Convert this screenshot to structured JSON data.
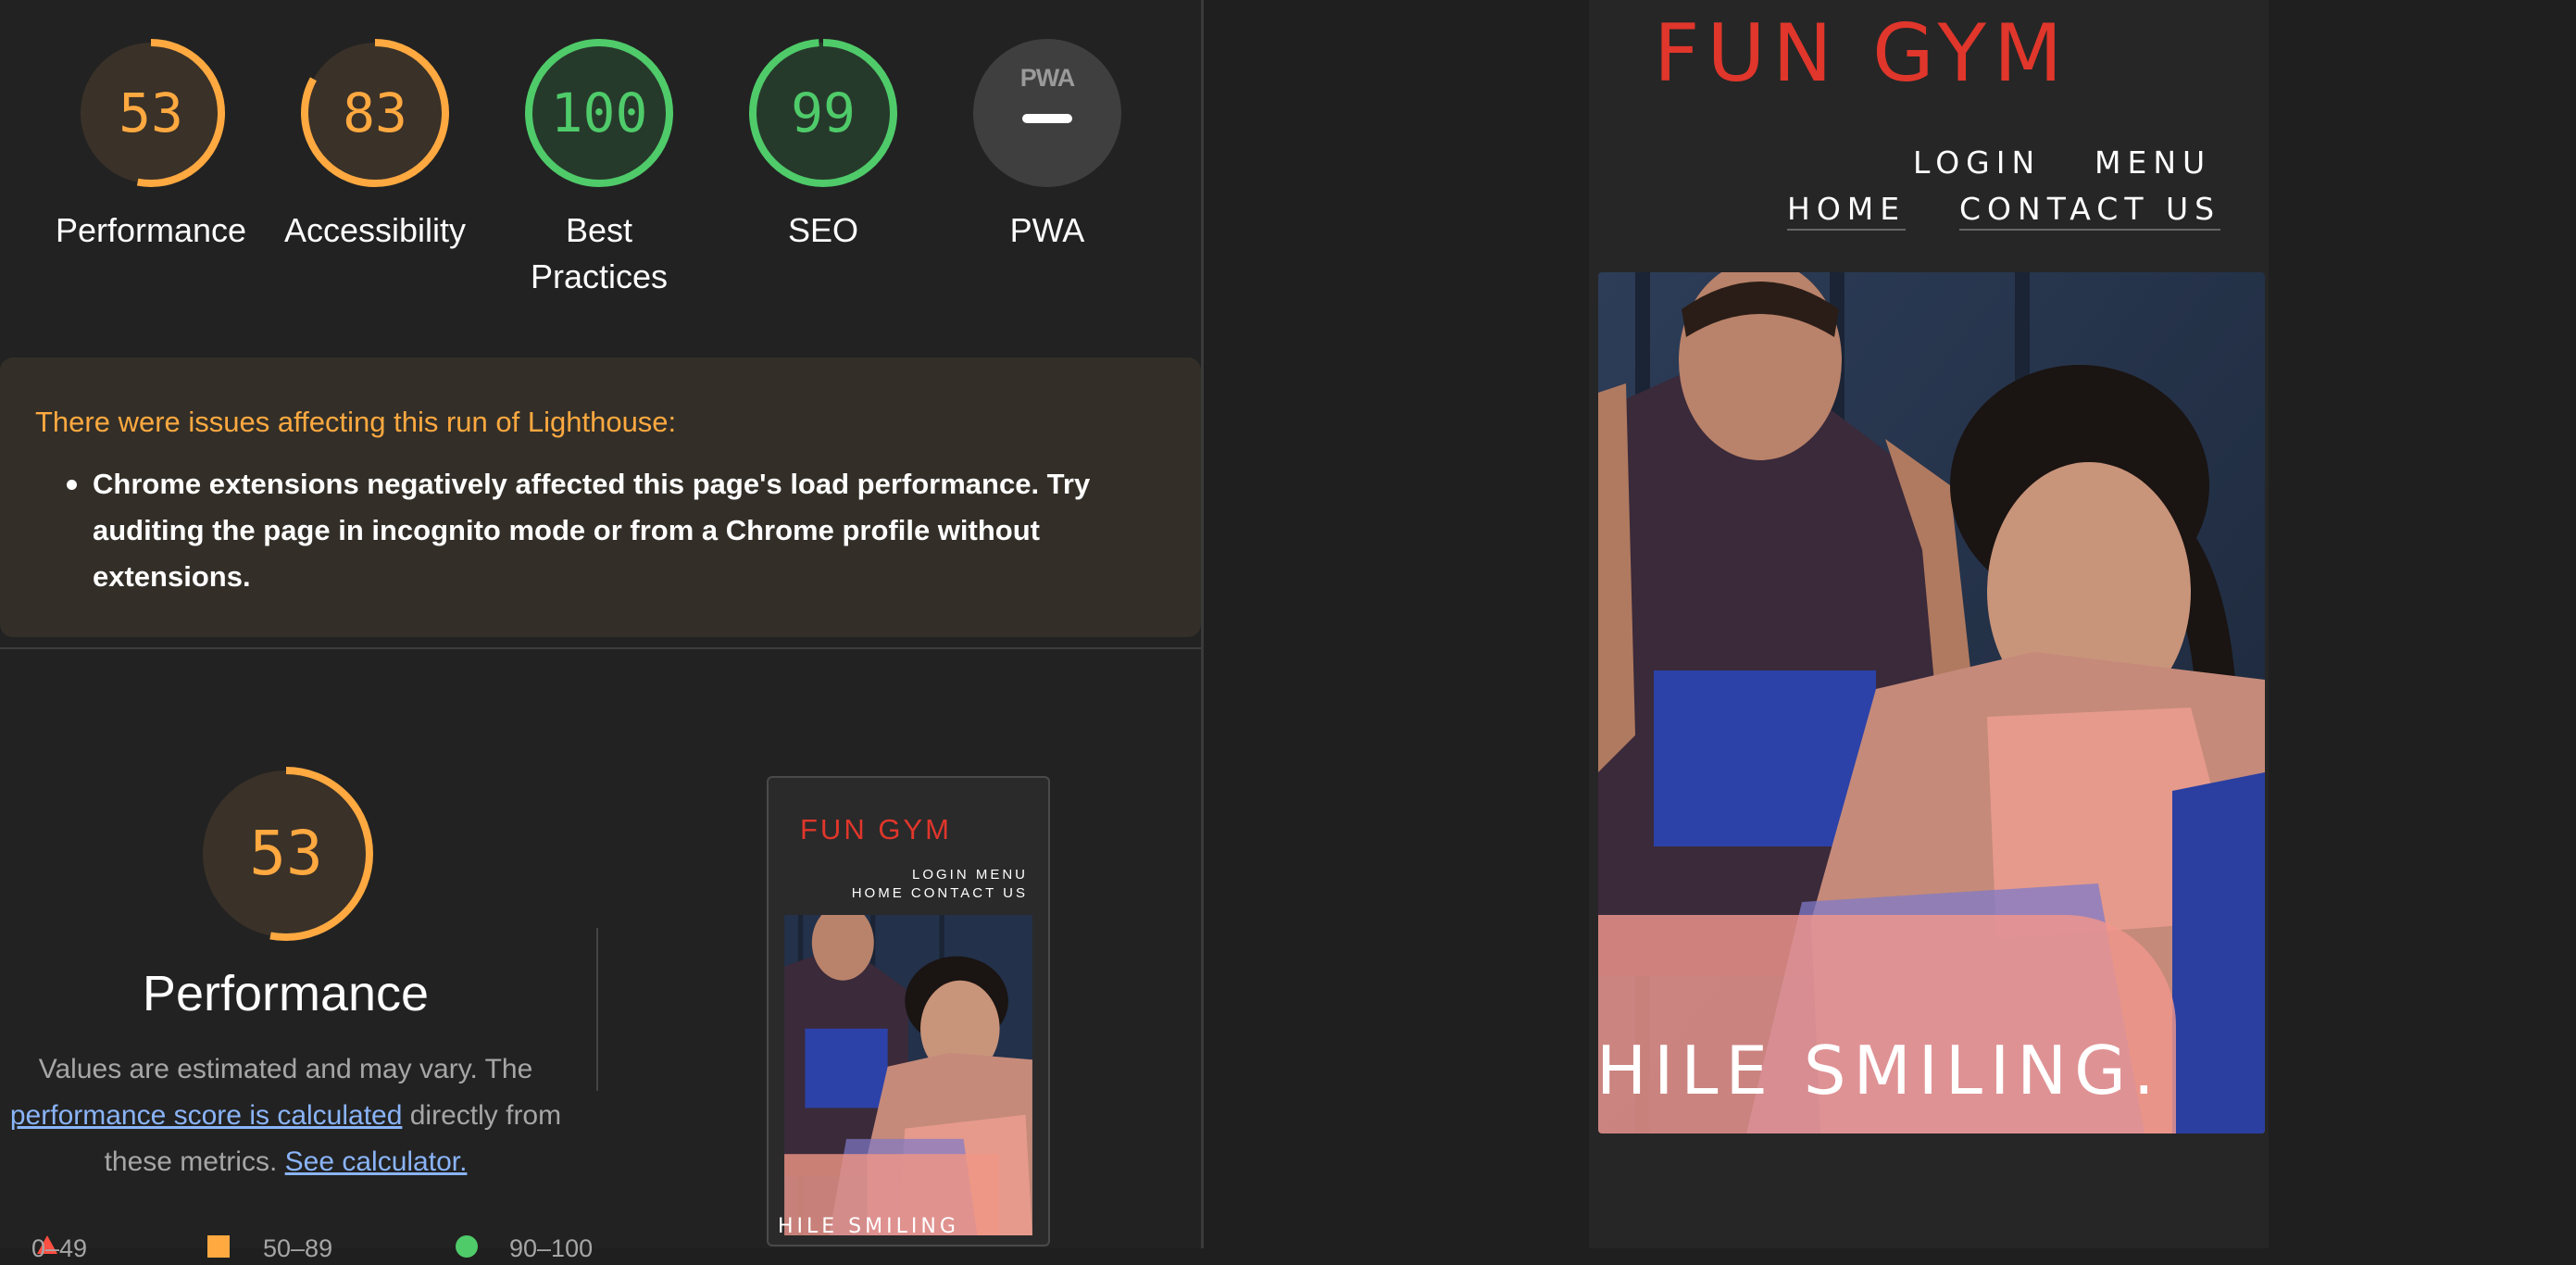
{
  "scores": [
    {
      "value": "53",
      "label": "Performance",
      "color": "#ffa940",
      "fraction": 0.53
    },
    {
      "value": "83",
      "label": "Accessibility",
      "color": "#ffa940",
      "fraction": 0.83
    },
    {
      "value": "100",
      "label": "Best Practices",
      "color": "#4fcb6a",
      "fraction": 1.0
    },
    {
      "value": "99",
      "label": "SEO",
      "color": "#4fcb6a",
      "fraction": 0.99
    },
    {
      "value": "",
      "label": "PWA",
      "color": "#9a9a9a",
      "badge": "PWA"
    }
  ],
  "warning": {
    "title": "There were issues affecting this run of Lighthouse:",
    "items": [
      "Chrome extensions negatively affected this page's load performance. Try auditing the page in incognito mode or from a Chrome profile without extensions."
    ]
  },
  "performance": {
    "score": "53",
    "fraction": 0.53,
    "title": "Performance",
    "desc_1": "Values are estimated and may vary. The",
    "link_1": "performance score is calculated",
    "desc_2": "directly from these metrics.",
    "link_2": "See calculator.",
    "legend": [
      "0–49",
      "50–89",
      "90–100"
    ],
    "legend_colors": [
      "#ff4e42",
      "#ffa940",
      "#4fcb6a"
    ]
  },
  "site": {
    "logo": "FUN GYM",
    "nav": [
      "LOGIN",
      "MENU",
      "HOME",
      "CONTACT US"
    ],
    "hero_text": "HILE SMILING."
  },
  "thumbnail": {
    "logo": "FUN GYM",
    "nav_row1": "LOGIN    MENU",
    "nav_row2": "HOME    CONTACT US",
    "hero_text": "HILE SMILING"
  },
  "colors": {
    "brand_red": "#e0362b",
    "orange": "#ffa940",
    "green": "#4fcb6a",
    "link": "#8ab4f8"
  }
}
